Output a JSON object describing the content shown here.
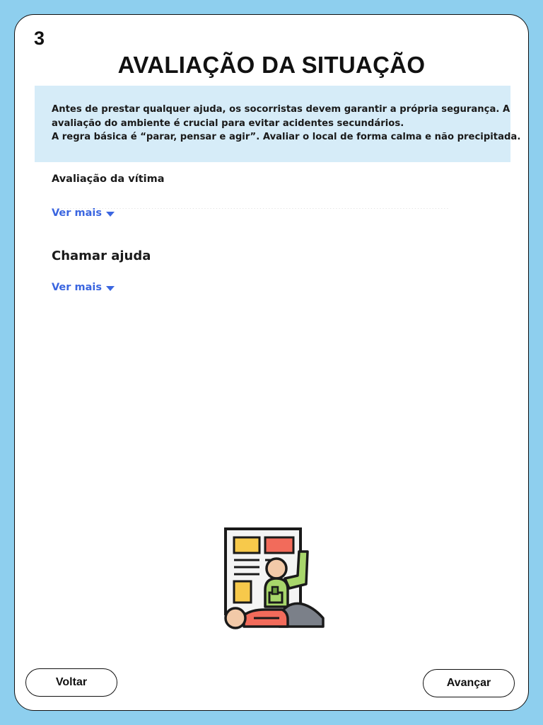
{
  "step": {
    "number": "3"
  },
  "page": {
    "title": "AVALIAÇÃO DA SITUAÇÃO"
  },
  "intro": {
    "lines": [
      "Antes de prestar qualquer ajuda, os socorristas devem garantir a própria segurança. A",
      "avaliação do ambiente é crucial para evitar acidentes secundários.",
      "A regra básica é “parar, pensar e agir”. Avaliar o local de forma calma e não precipitada."
    ]
  },
  "sections": [
    {
      "title": "Avaliação da vítima",
      "toggle_label": "Ver mais",
      "toggle_icon": "chevron-down-icon"
    },
    {
      "title": "Chamar ajuda",
      "toggle_label": "Ver mais",
      "toggle_icon": "chevron-down-icon"
    }
  ],
  "illustration": {
    "icon": "cpr-rescue-icon"
  },
  "footer": {
    "back_label": "Voltar",
    "next_label": "Avançar"
  },
  "colors": {
    "background": "#8ecfee",
    "card": "#ffffff",
    "intro_box": "#d6ecf8",
    "link": "#3b66e0"
  }
}
